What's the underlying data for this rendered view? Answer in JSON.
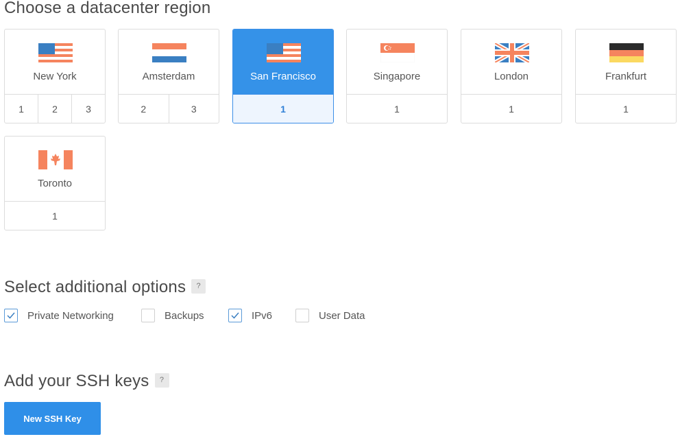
{
  "region_section": {
    "title": "Choose a datacenter region"
  },
  "regions": [
    {
      "name": "New York",
      "numbers": [
        "1",
        "2",
        "3"
      ],
      "selected": false,
      "flag": "us-flag-icon"
    },
    {
      "name": "Amsterdam",
      "numbers": [
        "2",
        "3"
      ],
      "selected": false,
      "flag": "nl-flag-icon"
    },
    {
      "name": "San Francisco",
      "numbers": [
        "1"
      ],
      "selected": true,
      "flag": "us-flag-icon"
    },
    {
      "name": "Singapore",
      "numbers": [
        "1"
      ],
      "selected": false,
      "flag": "sg-flag-icon"
    },
    {
      "name": "London",
      "numbers": [
        "1"
      ],
      "selected": false,
      "flag": "uk-flag-icon"
    },
    {
      "name": "Frankfurt",
      "numbers": [
        "1"
      ],
      "selected": false,
      "flag": "de-flag-icon"
    },
    {
      "name": "Toronto",
      "numbers": [
        "1"
      ],
      "selected": false,
      "flag": "ca-flag-icon"
    }
  ],
  "options_section": {
    "title": "Select additional options",
    "help": "?",
    "options": [
      {
        "label": "Private Networking",
        "checked": true
      },
      {
        "label": "Backups",
        "checked": false
      },
      {
        "label": "IPv6",
        "checked": true
      },
      {
        "label": "User Data",
        "checked": false
      }
    ]
  },
  "ssh_section": {
    "title": "Add your SSH keys",
    "help": "?",
    "button": "New SSH Key"
  },
  "colors": {
    "accent": "#3592e8",
    "flag_orange": "#f5845e",
    "flag_blue": "#3a7fc2"
  }
}
